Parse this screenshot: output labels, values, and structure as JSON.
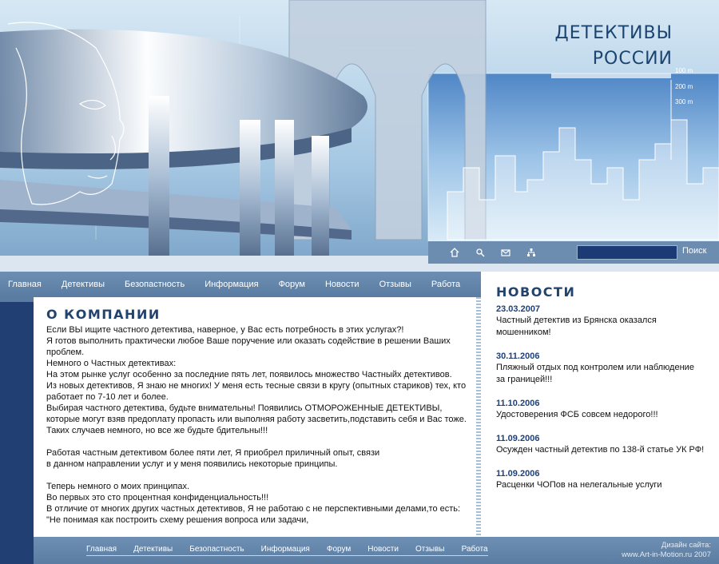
{
  "header": {
    "brand_line1": "ДЕТЕКТИВЫ",
    "brand_line2": "РОССИИ",
    "scale_marks": [
      "100 m",
      "200 m",
      "300 m"
    ]
  },
  "toolbar": {
    "icons": [
      "home-icon",
      "search-icon",
      "mail-icon",
      "sitemap-icon"
    ],
    "search_value": "",
    "search_button": "Поиск"
  },
  "nav": {
    "items": [
      "Главная",
      "Детективы",
      "Безопастность",
      "Информация",
      "Форум",
      "Новости",
      "Отзывы",
      "Работа"
    ]
  },
  "content": {
    "title": "О КОМПАНИИ",
    "paragraphs": [
      "Если ВЫ ищите частного детектива, наверное, у Вас есть потребность в этих услугах?!",
      "Я готов выполнить практически любое Ваше поручение или оказать содействие в решении Ваших проблем.",
      "Немного о Частных детективах:",
      "На этом рынке услуг особенно за последние пять лет, появилось множество Частныйх детективов.",
      "Из новых детективов, Я знаю не многих! У меня есть тесные связи в кругу (опытных стариков) тех, кто работает по 7-10 лет и более.",
      "Выбирая частного детектива, будьте внимательны! Появились ОТМОРОЖЕННЫЕ ДЕТЕКТИВЫ, которые могут взяв предоплату пропасть или выполняя работу засветить,подставить себя и Вас тоже.",
      "Таких случаев немного, но все же будьте бдительны!!!",
      "",
      "Работая частным детективом более пяти лет, Я приобрел приличный опыт, связи",
      "в данном направлении услуг и у меня появились некоторые принципы.",
      "",
      "Теперь немного о моих принципах.",
      "Во первых это сто процентная конфиденциальность!!!",
      "В отличие от многих других частных детективов, Я не работаю с не перспективными делами,то есть:",
      "\"Не понимая как построить схему решения вопроса или задачи,"
    ]
  },
  "news": {
    "title": "НОВОСТИ",
    "items": [
      {
        "date": "23.03.2007",
        "text": "Частный детектив из Брянска оказался мошенником!"
      },
      {
        "date": "30.11.2006",
        "text": "Пляжный отдых под контролем или наблюдение за границей!!!"
      },
      {
        "date": "11.10.2006",
        "text": "Удостоверения ФСБ совсем недорого!!!"
      },
      {
        "date": "11.09.2006",
        "text": "Осужден частный детектив по 138-й статье УК РФ!"
      },
      {
        "date": "11.09.2006",
        "text": "Расценки ЧОПов на нелегальные услуги"
      }
    ]
  },
  "footer": {
    "items": [
      "Главная",
      "Детективы",
      "Безопастность",
      "Информация",
      "Форум",
      "Новости",
      "Отзывы",
      "Работа"
    ],
    "credit_line1": "Дизайн сайта:",
    "credit_line2": "www.Art-in-Motion.ru  2007"
  },
  "colors": {
    "brand_dark": "#223f74",
    "nav_blue": "#5a7ca2",
    "heading_blue": "#22436e",
    "news_date": "#1f3f79"
  }
}
